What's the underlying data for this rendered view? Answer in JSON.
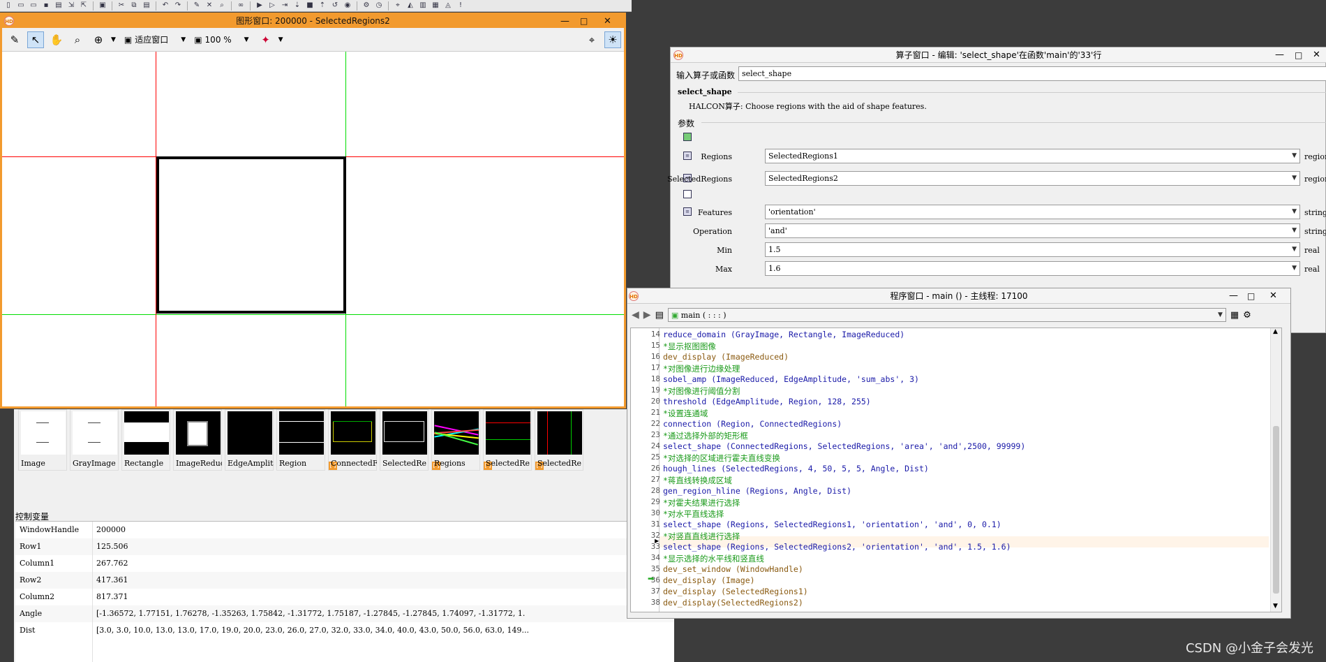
{
  "graphics_window": {
    "title": "图形窗口: 200000 - SelectedRegions2",
    "fit_label": "适应窗口",
    "zoom_label": "100 %"
  },
  "thumbnails": [
    {
      "label": "Image"
    },
    {
      "label": "GrayImage"
    },
    {
      "label": "Rectangle"
    },
    {
      "label": "ImageReduc"
    },
    {
      "label": "EdgeAmplit"
    },
    {
      "label": "Region"
    },
    {
      "label": "ConnectedF"
    },
    {
      "label": "SelectedRe"
    },
    {
      "label": "Regions"
    },
    {
      "label": "SelectedRe"
    },
    {
      "label": "SelectedRe"
    }
  ],
  "control_variables": {
    "title": "控制变量",
    "rows": [
      {
        "name": "WindowHandle",
        "value": "200000"
      },
      {
        "name": "Row1",
        "value": "125.506"
      },
      {
        "name": "Column1",
        "value": "267.762"
      },
      {
        "name": "Row2",
        "value": "417.361"
      },
      {
        "name": "Column2",
        "value": "817.371"
      },
      {
        "name": "Angle",
        "value": "[-1.36572, 1.77151, 1.76278, -1.35263, 1.75842, -1.31772, 1.75187, -1.27845, -1.27845, 1.74097, -1.31772, 1."
      },
      {
        "name": "Dist",
        "value": "[3.0, 3.0, 10.0, 13.0, 13.0, 17.0, 19.0, 20.0, 23.0, 26.0, 27.0, 32.0, 33.0, 34.0, 40.0, 43.0, 50.0, 56.0, 63.0, 149..."
      }
    ]
  },
  "operator_window": {
    "title": "算子窗口 - 编辑: 'select_shape'在函数'main'的'33'行",
    "input_label": "输入算子或函数",
    "input_value": "select_shape",
    "op_name": "select_shape",
    "op_desc": "HALCON算子: Choose regions with the aid of shape features.",
    "params_label": "参数",
    "params": [
      {
        "name": "Regions",
        "value": "SelectedRegions1",
        "type": "region"
      },
      {
        "name": "SelectedRegions",
        "value": "SelectedRegions2",
        "type": "region"
      },
      {
        "name": "Features",
        "value": "'orientation'",
        "type": "string"
      },
      {
        "name": "Operation",
        "value": "'and'",
        "type": "string"
      },
      {
        "name": "Min",
        "value": "1.5",
        "type": "real"
      },
      {
        "name": "Max",
        "value": "1.6",
        "type": "real"
      }
    ]
  },
  "program_window": {
    "title": "程序窗口 - main () - 主线程: 17100",
    "proc_label": "main ( : : : )",
    "lines": [
      {
        "n": "14",
        "text": "reduce_domain (GrayImage, Rectangle, ImageReduced)",
        "kind": "op"
      },
      {
        "n": "15",
        "text": "*显示抠图图像",
        "kind": "comment"
      },
      {
        "n": "16",
        "text": "dev_display (ImageReduced)",
        "kind": "dev"
      },
      {
        "n": "17",
        "text": "*对图像进行边缘处理",
        "kind": "comment"
      },
      {
        "n": "18",
        "text": "sobel_amp (ImageReduced, EdgeAmplitude, 'sum_abs', 3)",
        "kind": "op"
      },
      {
        "n": "19",
        "text": "*对图像进行阈值分割",
        "kind": "comment"
      },
      {
        "n": "20",
        "text": "threshold (EdgeAmplitude, Region, 128, 255)",
        "kind": "op"
      },
      {
        "n": "21",
        "text": "*设置连通域",
        "kind": "comment"
      },
      {
        "n": "22",
        "text": "connection (Region, ConnectedRegions)",
        "kind": "op"
      },
      {
        "n": "23",
        "text": "*通过选择外部的矩形框",
        "kind": "comment"
      },
      {
        "n": "24",
        "text": "select_shape (ConnectedRegions, SelectedRegions, 'area', 'and',2500, 99999)",
        "kind": "op"
      },
      {
        "n": "25",
        "text": "*对选择的区域进行霍夫直线变换",
        "kind": "comment"
      },
      {
        "n": "26",
        "text": "hough_lines (SelectedRegions, 4, 50, 5, 5, Angle, Dist)",
        "kind": "op"
      },
      {
        "n": "27",
        "text": "*蒋直线转换成区域",
        "kind": "comment"
      },
      {
        "n": "28",
        "text": "gen_region_hline (Regions, Angle, Dist)",
        "kind": "op"
      },
      {
        "n": "29",
        "text": "*对霍夫结果进行选择",
        "kind": "comment"
      },
      {
        "n": "30",
        "text": "*对水平直线选择",
        "kind": "comment"
      },
      {
        "n": "31",
        "text": "select_shape (Regions, SelectedRegions1, 'orientation', 'and', 0, 0.1)",
        "kind": "op"
      },
      {
        "n": "32",
        "text": "*对竖直直线进行选择",
        "kind": "comment"
      },
      {
        "n": "33",
        "text": "select_shape (Regions, SelectedRegions2, 'orientation', 'and', 1.5, 1.6)",
        "kind": "op"
      },
      {
        "n": "34",
        "text": "*显示选择的水平线和竖直线",
        "kind": "comment"
      },
      {
        "n": "35",
        "text": "dev_set_window (WindowHandle)",
        "kind": "dev"
      },
      {
        "n": "36",
        "text": "dev_display (Image)",
        "kind": "dev"
      },
      {
        "n": "37",
        "text": "dev_display (SelectedRegions1)",
        "kind": "dev"
      },
      {
        "n": "38",
        "text": "dev_display(SelectedRegions2)",
        "kind": "dev"
      }
    ]
  },
  "watermark": "CSDN @小金子会发光"
}
